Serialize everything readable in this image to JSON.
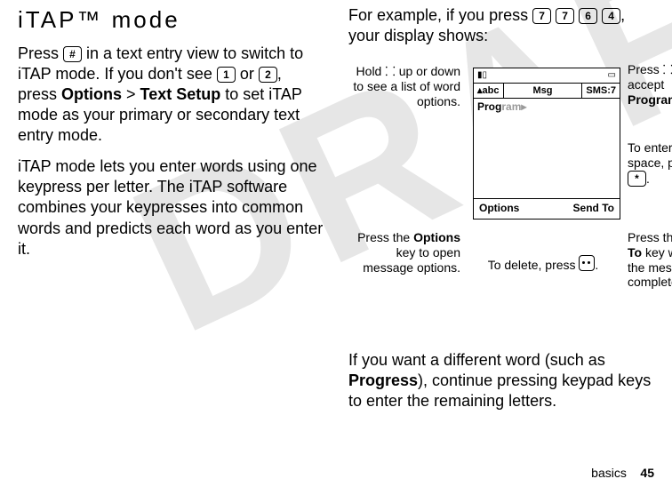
{
  "left": {
    "heading": "iTAP™ mode",
    "p1a": "Press ",
    "key_hash": "#",
    "p1b": " in a text entry view to switch to iTAP mode. If you don't see ",
    "key_1": "1",
    "p1c": " or ",
    "key_2": "2",
    "p1d": ", press ",
    "opt": "Options",
    "gt": " > ",
    "txtsetup": "Text Setup",
    "p1e": " to set iTAP mode as your primary or secondary text entry mode.",
    "p2": "iTAP mode lets you enter words using one keypress per letter. The iTAP software combines your keypresses into common words and predicts each word as you enter it."
  },
  "right": {
    "p1a": "For example, if you press ",
    "k7": "7",
    "k7b": "7",
    "k6": "6",
    "k4": "4",
    "p1b": ", your display shows:",
    "p2a": "If you want a different word (such as ",
    "progress": "Progress",
    "p2b": "), continue pressing keypad keys to enter the remaining letters."
  },
  "phone": {
    "mode_left": "abc",
    "mode_mid": "Msg",
    "mode_right": "SMS:7",
    "typed": "Prog",
    "suggestion": "ram",
    "soft_left": "Options",
    "soft_right": "Send To"
  },
  "callouts": {
    "hold_updown": "Hold ⸬ up or down to see a list of word options.",
    "press_options_a": "Press the ",
    "press_options_key": "Options",
    "press_options_b": " key to open message options.",
    "to_delete_a": "To delete, press ",
    "to_delete_b": ".",
    "press_right_a": "Press ⸬ right to accept ",
    "press_right_word": "Program",
    "press_right_b": ".",
    "space_a": "To enter a space, press ",
    "space_key": "*",
    "space_b": ".",
    "sendto_a": "Press the ",
    "sendto_key": "Send To",
    "sendto_b": " key when the message is complete."
  },
  "footer": {
    "label": "basics",
    "page": "45"
  }
}
